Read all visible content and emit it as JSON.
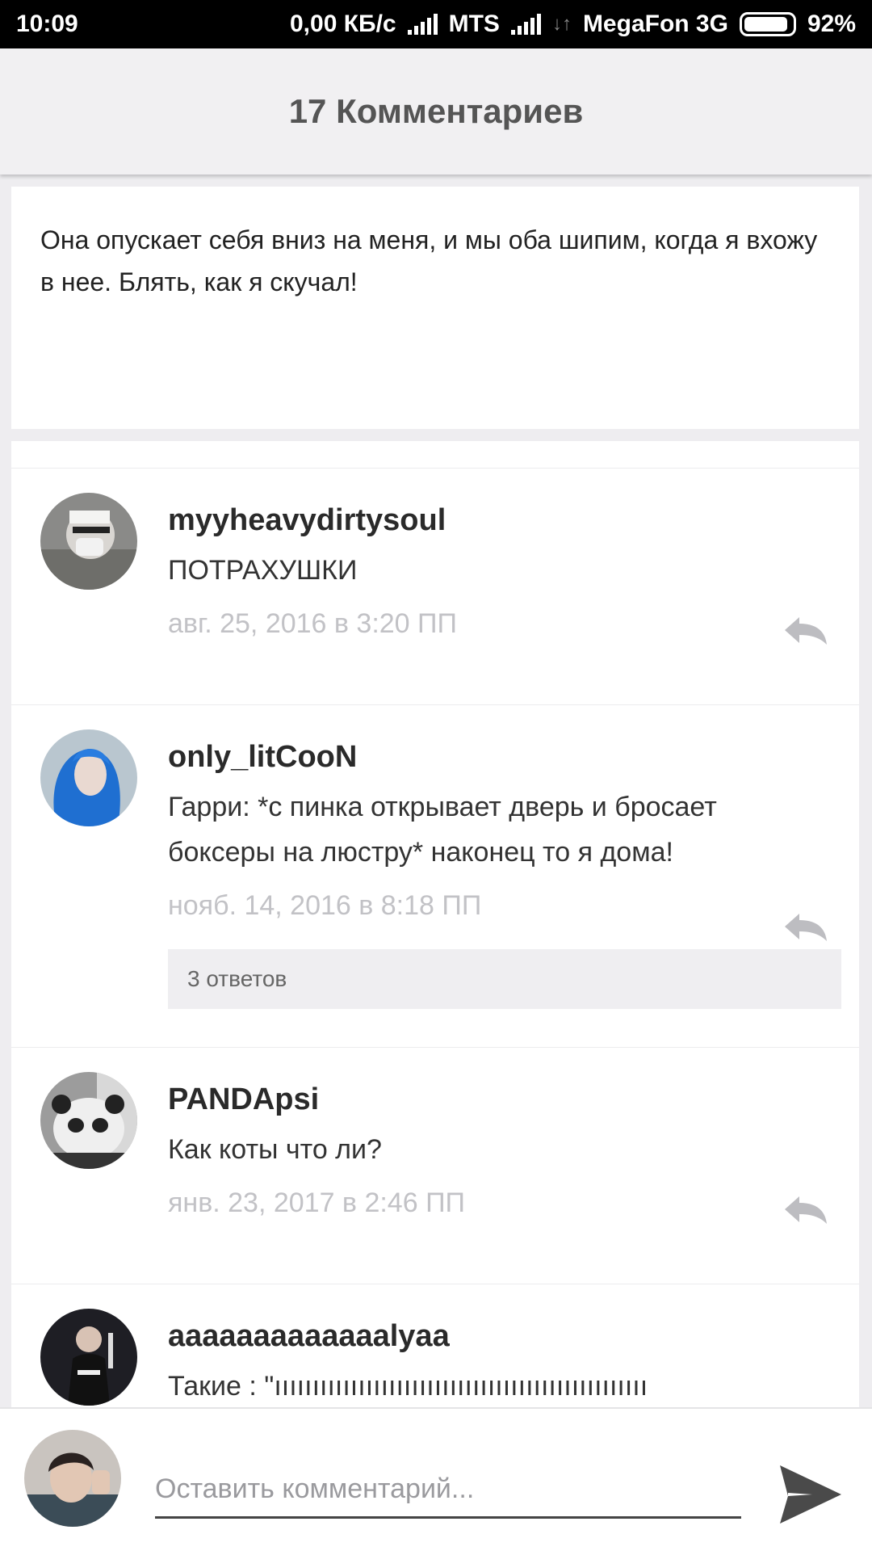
{
  "status_bar": {
    "time": "10:09",
    "speed": "0,00 КБ/с",
    "carrier1": "MTS",
    "carrier2": "MegaFon 3G",
    "battery": "92%",
    "battery_level": 0.92
  },
  "header": {
    "title": "17 Комментариев"
  },
  "story": {
    "text": "Она опускает себя вниз на меня, и мы оба шипим, когда я вхожу в нее. Блять, как я скучал!"
  },
  "comments": [
    {
      "username": "myyheavydirtysoul",
      "text": "ПОТРАХУШКИ",
      "date": "авг. 25, 2016 в 3:20 ПП"
    },
    {
      "username": "only_litCooN",
      "text": "Гарри: *с пинка открывает дверь и бросает боксеры на люстру* наконец то я дома!",
      "date": "нояб. 14, 2016 в 8:18 ПП",
      "replies": "3 ответов"
    },
    {
      "username": "PANDApsi",
      "text": "Как коты что ли?",
      "date": "янв. 23, 2017 в 2:46 ПП"
    },
    {
      "username": "aaaaaaaaaaaaalyaa",
      "text": "Такие : \"ııııııııııııııııııııııııııııııııııııııııııııııııı"
    }
  ],
  "input": {
    "placeholder": "Оставить комментарий..."
  },
  "colors": {
    "header_bg": "#f1f0f2",
    "page_bg": "#eeedf0",
    "date_gray": "#c2c2c6",
    "reply_icon": "#bdbdc1"
  },
  "icons": {
    "reply": "reply-arrow-icon",
    "send": "send-icon"
  }
}
